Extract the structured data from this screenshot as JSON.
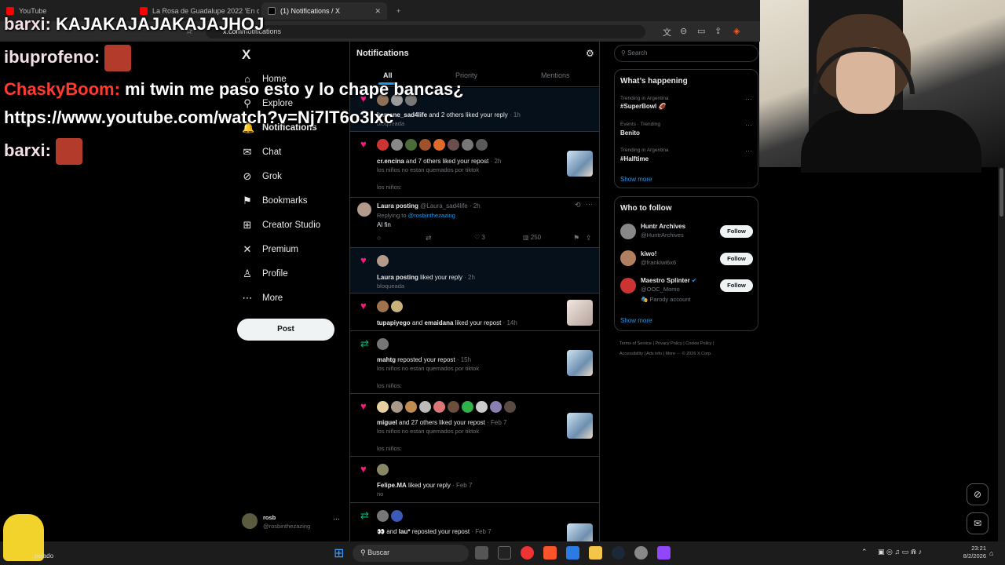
{
  "browser": {
    "tabs": [
      {
        "title": "YouTube",
        "color": "#ff0000"
      },
      {
        "title": "La Rosa de Guadalupe 2022 'En cada",
        "color": "#ff0000"
      },
      {
        "title": "(1) Notifications / X",
        "color": "#ffffff"
      }
    ],
    "url_host": "x.com",
    "url_path": "/notifications"
  },
  "chat_overlay": [
    {
      "user": "barxi:",
      "message": "KAJAKAJAJAKAJAJHOJ"
    },
    {
      "user": "ibuprofeno:",
      "message": ""
    },
    {
      "user": "ChaskyBoom:",
      "message": "mi twin me paso esto y lo chape bancas¿"
    },
    {
      "user": "",
      "message": "https://www.youtube.com/watch?v=Nj7lT6o3Ixc"
    },
    {
      "user": "barxi:",
      "message": ""
    }
  ],
  "nav": {
    "logo": "X",
    "items": [
      {
        "label": "Home",
        "icon": "home-icon",
        "glyph": "⌂"
      },
      {
        "label": "Explore",
        "icon": "search-icon",
        "glyph": "⚲"
      },
      {
        "label": "Notifications",
        "icon": "bell-icon",
        "glyph": "🔔"
      },
      {
        "label": "Chat",
        "icon": "mail-icon",
        "glyph": "✉"
      },
      {
        "label": "Grok",
        "icon": "grok-icon",
        "glyph": "⊘"
      },
      {
        "label": "Bookmarks",
        "icon": "bookmark-icon",
        "glyph": "⚑"
      },
      {
        "label": "Creator Studio",
        "icon": "creator-studio-icon",
        "glyph": "⊞"
      },
      {
        "label": "Premium",
        "icon": "x-premium-icon",
        "glyph": "✕"
      },
      {
        "label": "Profile",
        "icon": "person-icon",
        "glyph": "♙"
      },
      {
        "label": "More",
        "icon": "more-circle-icon",
        "glyph": "⋯"
      }
    ],
    "post_label": "Post",
    "account": {
      "name": "rosb",
      "handle": "@rosbinthezazing",
      "more": "···"
    }
  },
  "notifications_page": {
    "title": "Notifications",
    "tabs": [
      "All",
      "Priority",
      "Mentions"
    ],
    "active_tab": "All",
    "items": [
      {
        "type": "like",
        "actor": "kamane_sad4life",
        "text": "and 2 others liked your reply",
        "time": "· 1h",
        "sub": "bloqueada",
        "sub2": ""
      },
      {
        "type": "like",
        "actor": "cr.encina",
        "text": "and 7 others liked your repost",
        "time": "· 2h",
        "sub": "los niños no estan quemados por tiktok",
        "sub2": "los niños:"
      },
      {
        "type": "reply",
        "author": "Laura posting",
        "handle": "@Laura_sad4life",
        "time": "· 2h",
        "replying_to": "Replying to",
        "replying_handle": "@rosbinthezazing",
        "body": "Al fin",
        "likes": "3",
        "views": "250"
      },
      {
        "type": "like",
        "actor": "Laura posting",
        "text": "liked your reply",
        "time": "· 2h",
        "sub": "bloqueada",
        "sub2": ""
      },
      {
        "type": "like",
        "actor": "tupapiyego",
        "text": "and",
        "actor2": "emaidana",
        "text2": "liked your repost",
        "time": "· 14h",
        "sub": "",
        "sub2": ""
      },
      {
        "type": "repost",
        "actor": "mahtg",
        "text": "reposted your repost",
        "time": "· 15h",
        "sub": "los niños no estan quemados por tiktok",
        "sub2": "los niños:"
      },
      {
        "type": "like",
        "actor": "miguel",
        "text": "and 27 others liked your repost",
        "time": "· Feb 7",
        "sub": "los niños no estan quemados por tiktok",
        "sub2": "los niños:"
      },
      {
        "type": "like",
        "actor": "Felipe.MA",
        "text": "liked your reply",
        "time": "· Feb 7",
        "sub": "no",
        "sub2": ""
      },
      {
        "type": "repost",
        "actor": "👀",
        "text": "and",
        "actor2": "lau*",
        "text2": "reposted your repost",
        "time": "· Feb 7",
        "sub": "",
        "sub2": ""
      }
    ]
  },
  "sidebar": {
    "search_placeholder": "Search",
    "whats_happening": {
      "title": "What’s happening",
      "trends": [
        {
          "meta": "Trending in Argentina",
          "name": "#SuperBowl 🏈"
        },
        {
          "meta": "Events · Trending",
          "name": "Benito"
        },
        {
          "meta": "Trending in Argentina",
          "name": "#Halftime"
        }
      ],
      "show_more": "Show more"
    },
    "who_to_follow": {
      "title": "Who to follow",
      "accounts": [
        {
          "name": "Huntr Archives",
          "handle": "@HuntrArchives",
          "extra": ""
        },
        {
          "name": "kiwo!",
          "handle": "@frankiwi6x6",
          "extra": ""
        },
        {
          "name": "Maestro Splinter",
          "handle": "@OOC_Momo",
          "extra": "🎭 Parody account",
          "verified": true
        }
      ],
      "follow_label": "Follow",
      "show_more": "Show more"
    },
    "footer": [
      "Terms of Service",
      "Privacy Policy",
      "Cookie Policy",
      "Accessibility",
      "Ads info",
      "More ···",
      "© 2026 X Corp."
    ]
  },
  "taskbar": {
    "search_label": "Buscar",
    "time": "23:21",
    "date": "8/2/2026",
    "left_label": "pejado"
  },
  "colors": {
    "accent": "#1d9bf0",
    "like": "#f91880",
    "repost": "#00ba7c"
  }
}
